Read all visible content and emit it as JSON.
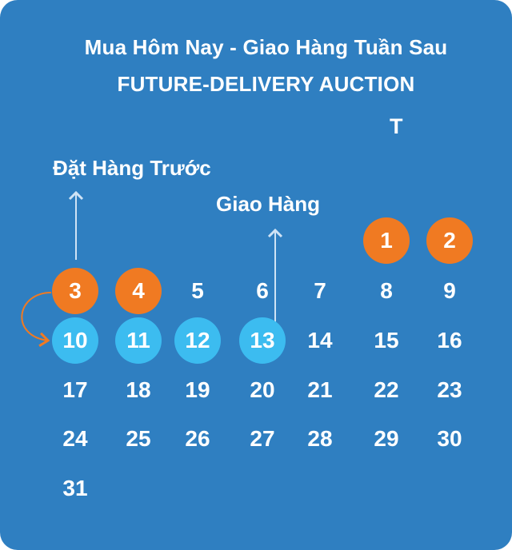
{
  "title_line1": "Mua Hôm Nay - Giao Hàng Tuần Sau",
  "title_line2": "FUTURE-DELIVERY AUCTION",
  "weekday_label": "T",
  "preorder_label": "Đặt Hàng Trước",
  "delivery_label": "Giao Hàng",
  "calendar": {
    "days": [
      {
        "day": "1",
        "highlight": "order"
      },
      {
        "day": "2",
        "highlight": "order"
      },
      {
        "day": "3",
        "highlight": "order"
      },
      {
        "day": "4",
        "highlight": "order"
      },
      {
        "day": "5",
        "highlight": "none"
      },
      {
        "day": "6",
        "highlight": "none"
      },
      {
        "day": "7",
        "highlight": "none"
      },
      {
        "day": "8",
        "highlight": "none"
      },
      {
        "day": "9",
        "highlight": "none"
      },
      {
        "day": "10",
        "highlight": "delivery"
      },
      {
        "day": "11",
        "highlight": "delivery"
      },
      {
        "day": "12",
        "highlight": "delivery"
      },
      {
        "day": "13",
        "highlight": "delivery"
      },
      {
        "day": "14",
        "highlight": "none"
      },
      {
        "day": "15",
        "highlight": "none"
      },
      {
        "day": "16",
        "highlight": "none"
      },
      {
        "day": "17",
        "highlight": "none"
      },
      {
        "day": "18",
        "highlight": "none"
      },
      {
        "day": "19",
        "highlight": "none"
      },
      {
        "day": "20",
        "highlight": "none"
      },
      {
        "day": "21",
        "highlight": "none"
      },
      {
        "day": "22",
        "highlight": "none"
      },
      {
        "day": "23",
        "highlight": "none"
      },
      {
        "day": "24",
        "highlight": "none"
      },
      {
        "day": "25",
        "highlight": "none"
      },
      {
        "day": "26",
        "highlight": "none"
      },
      {
        "day": "27",
        "highlight": "none"
      },
      {
        "day": "28",
        "highlight": "none"
      },
      {
        "day": "29",
        "highlight": "none"
      },
      {
        "day": "30",
        "highlight": "none"
      },
      {
        "day": "31",
        "highlight": "none"
      }
    ]
  },
  "colors": {
    "background": "#2f7fc1",
    "order": "#f07a22",
    "delivery": "#3cbcf0",
    "text": "#ffffff",
    "arrow": "#cfe3f5"
  }
}
